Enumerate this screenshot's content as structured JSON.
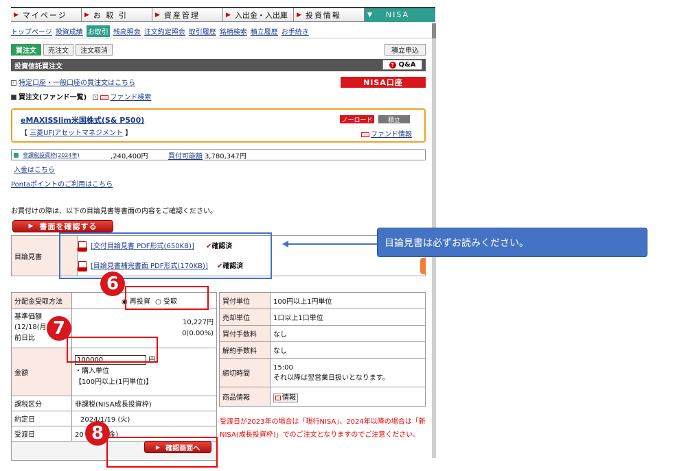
{
  "nav": {
    "items": [
      "マイページ",
      "お 取 引",
      "資産管理",
      "入出金・入出庫",
      "投資情報",
      "NISA"
    ]
  },
  "subnav": {
    "items": [
      "トップページ",
      "投資成績",
      "お取引",
      "残高照会",
      "注文約定照会",
      "取引履歴",
      "銘柄検索",
      "積立履歴",
      "お手続き"
    ]
  },
  "tabs": {
    "buy": "買注文",
    "sell": "売注文",
    "cancel": "注文取消",
    "tsumitate": "積立申込"
  },
  "header": {
    "title": "投資信託買注文",
    "qa": "Q&A"
  },
  "links": {
    "tokutei": "特定口座・一般口座の買注文はこちら",
    "fund_list": "買注文(ファンド一覧)",
    "fund_search": "ファンド検索",
    "nisa_account": "NISA口座"
  },
  "fund": {
    "name": "eMAXISSlim米国株式(S& P500)",
    "company": "三菱UFJアセットマネジメント",
    "bracket_open": "【",
    "bracket_close": "】",
    "noload": "ノーロード",
    "tsumitate": "積立",
    "info_link": "ファンド情報"
  },
  "balance": {
    "label": "非課税投資枠(2024年)",
    "amount": ",240,400円",
    "available_label": "買付可能額",
    "available_amount": "3,780,347円"
  },
  "links2": {
    "deposit": "入金はこちら",
    "ponta": "Pontaポイントのご利用はこちら"
  },
  "notice": "お買付けの際は、以下の目論見書等書面の内容をご確認ください。",
  "confirm_docs_button": "書面を確認する",
  "prospectus": {
    "label": "目論見書",
    "doc1": "[交付目論見書 PDF形式(650KB)]",
    "doc2": "[目論見書補完書面 PDF形式(170KB)]",
    "confirmed": "確認済"
  },
  "callout": "目論見書は必ずお読みください。",
  "form": {
    "dividend_label": "分配金受取方法",
    "reinvest": "再投資",
    "receive": "受取",
    "nav_label_a": "基準価額",
    "nav_label_b": "(12/18(月)現在)",
    "nav_value": "10,227円",
    "prev_label": "前日比",
    "prev_value": "0(0.00%)",
    "amount_label": "金額",
    "amount_value": "100000",
    "amount_unit": "円",
    "purchase_unit_label": "・購入単位",
    "purchase_unit": "【100円以上(1円単位)】",
    "tax_label": "課税区分",
    "tax_value": "非課税(NISA成長投資枠)",
    "trade_date_label": "約定日",
    "trade_date": "2024/1/19 (火)",
    "settle_label": "受渡日",
    "settle_prefix": "20",
    "settle_suffix": "22(金)"
  },
  "info": {
    "buy_unit_label": "買付単位",
    "buy_unit": "100円以上1円単位",
    "sell_unit_label": "売却単位",
    "sell_unit": "1口以上1口単位",
    "buy_fee_label": "買付手数料",
    "buy_fee": "なし",
    "cancel_fee_label": "解約手数料",
    "cancel_fee": "なし",
    "cutoff_label": "締切時間",
    "cutoff_time": "15:00",
    "cutoff_note": "それ以降は翌営業日扱いとなります。",
    "product_label": "商品情報",
    "product_btn": "情報"
  },
  "red_note": "受渡日が2023年の場合は「現行NISA」、2024年以降の場合は「新NISA(成長投資枠)」でのご注文となりますのでご注意ください。",
  "submit_button": "確認画面へ",
  "steps": [
    "6",
    "7",
    "8"
  ]
}
